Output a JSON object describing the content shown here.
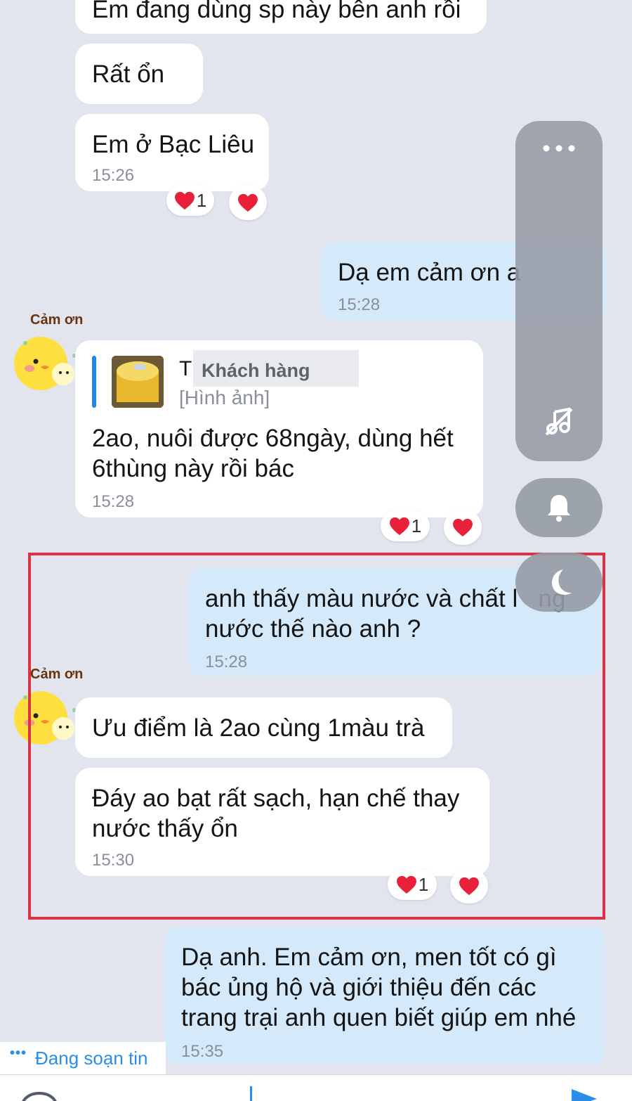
{
  "messages": [
    {
      "text": "Em đang dùng sp này bên anh rồi"
    },
    {
      "text": "Rất ổn"
    },
    {
      "text": "Em ở Bạc Liêu",
      "time": "15:26",
      "reaction_count": "1"
    },
    {
      "text": "Dạ em cảm ơn a",
      "time": "15:28"
    },
    {
      "quote_name_initial": "T",
      "quote_name_overlay": "Khách hàng",
      "quote_type": "[Hình ảnh]",
      "text": "2ao, nuôi được 68ngày, dùng hết\n6thùng này rồi bác",
      "time": "15:28",
      "reaction_count": "1"
    },
    {
      "text": "anh thấy màu nước và chất l   ng\nnước thế nào anh ?",
      "time": "15:28"
    },
    {
      "text": "Ưu điểm là 2ao cùng 1màu trà"
    },
    {
      "text": "Đáy ao bạt rất sạch, hạn chế thay\nnước thấy ổn",
      "time": "15:30",
      "reaction_count": "1"
    },
    {
      "text": "Dạ anh. Em cảm ơn, men tốt có gì\nbác ủng hộ và giới thiệu đến các\ntrang trại anh quen biết giúp em nhé",
      "time": "15:35"
    }
  ],
  "sticker_label": "Cảm ơn",
  "typing_indicator": "Đang soạn tin",
  "colors": {
    "background": "#e2e5ee",
    "incoming_bubble": "#ffffff",
    "outgoing_bubble": "#d4eafb",
    "highlight_border": "#d93445",
    "accent": "#2a8ee8",
    "heart": "#e8203a"
  },
  "icons": [
    "more-icon",
    "music-off-icon",
    "bell-icon",
    "moon-icon",
    "heart-icon"
  ]
}
